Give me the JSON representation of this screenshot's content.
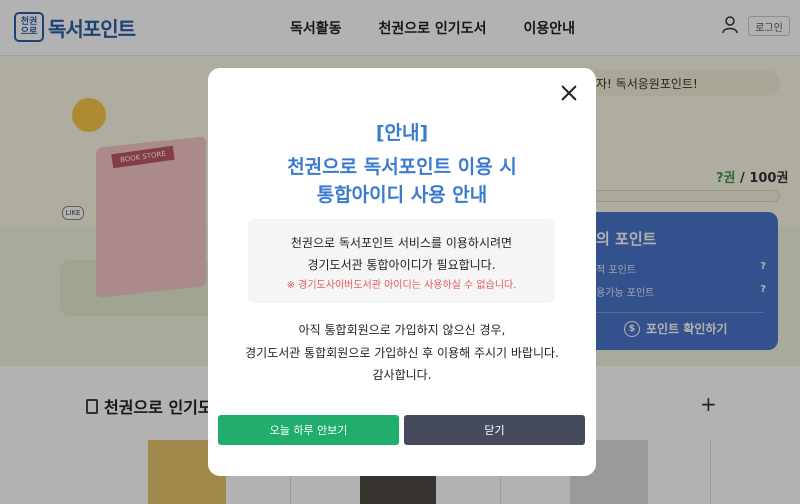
{
  "header": {
    "logo_mark_top": "천권",
    "logo_mark_bottom": "으로",
    "logo_text": "독서포인트",
    "nav": [
      "독서활동",
      "천권으로 인기도서",
      "이용안내"
    ],
    "login_label": "로그인"
  },
  "hero": {
    "store_sign": "BOOK STORE",
    "like_label": "LIKE",
    "slogan": "자! 독서응원포인트!",
    "progress_prefix": "?권",
    "progress_suffix": " / 100권",
    "progress_fraction": 0,
    "points": {
      "title": "의 포인트",
      "rows": [
        {
          "label": "적 포인트",
          "value": "?"
        },
        {
          "label": "용가능 포인트",
          "value": "?"
        }
      ],
      "check_label": "포인트 확인하기"
    }
  },
  "section": {
    "title": "천권으로 인기도"
  },
  "modal": {
    "tag": "[안내]",
    "title_line1": "천권으로 독서포인트 이용 시",
    "title_line2": "통합아이디 사용 안내",
    "info_line1": "천권으로 독서포인트 서비스를 이용하시려면",
    "info_line2": "경기도서관 통합아이디가 필요합니다.",
    "info_warning": "※ 경기도사이버도서관 아이디는 사용하실 수 없습니다.",
    "body_line1": "아직 통합회원으로 가입하지 않으신 경우,",
    "body_line2": "경기도서관 통합회원으로 가입하신 후 이용해 주시기 바랍니다.",
    "body_line3": "감사합니다.",
    "btn_today": "오늘 하루 안보기",
    "btn_close": "닫기"
  },
  "colors": {
    "accent_blue": "#3a7bd0",
    "green_button": "#21ad6c",
    "dark_button": "#454b5c",
    "warning_red": "#e35a5a"
  }
}
